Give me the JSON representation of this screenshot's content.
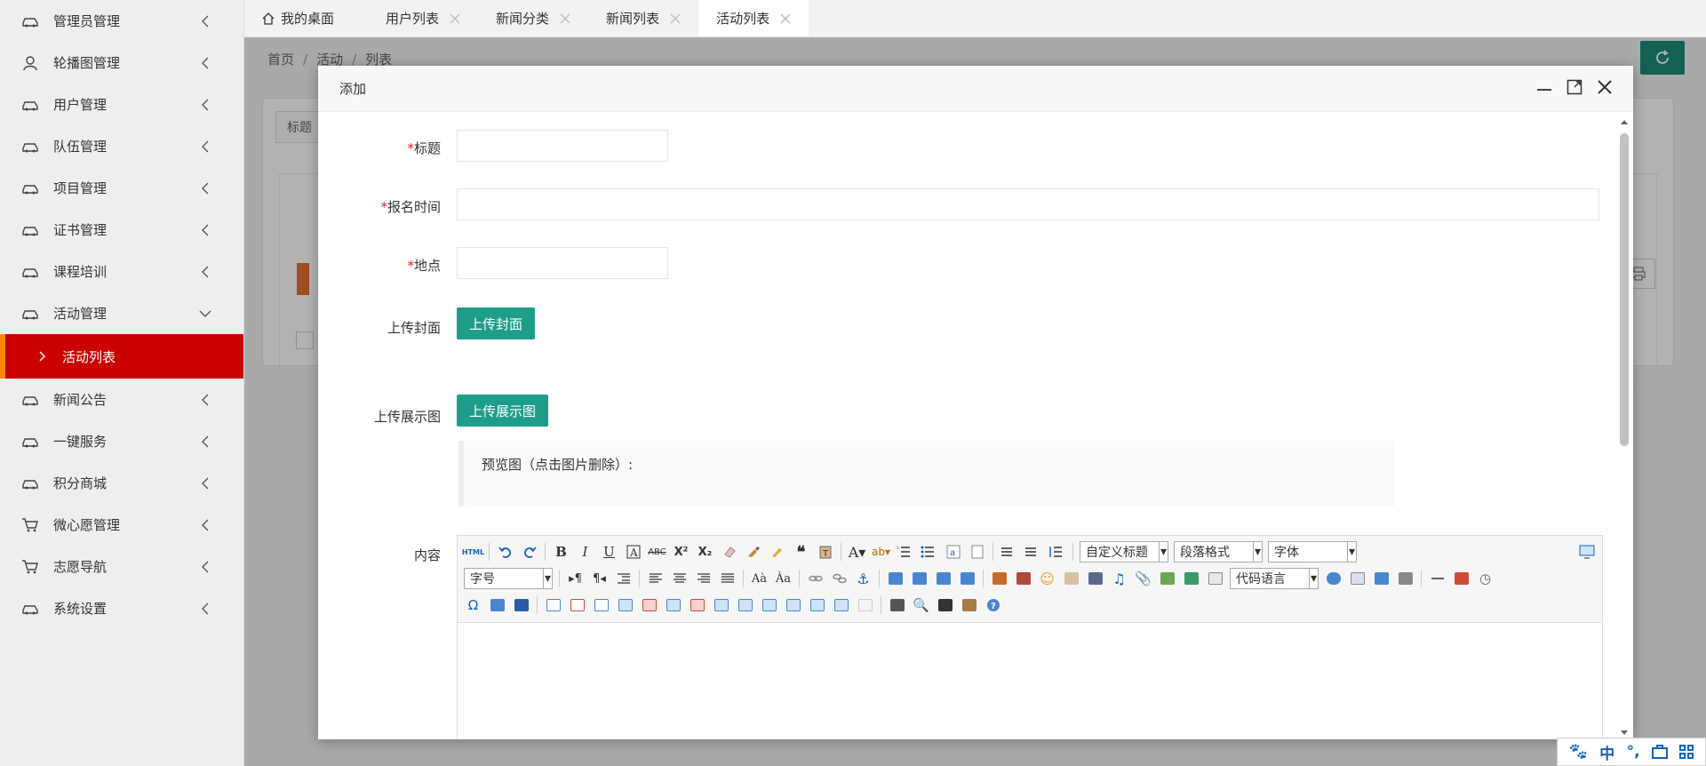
{
  "sidebar": {
    "items": [
      {
        "label": "管理员管理",
        "icon": "car-icon"
      },
      {
        "label": "轮播图管理",
        "icon": "user-icon"
      },
      {
        "label": "用户管理",
        "icon": "car-icon"
      },
      {
        "label": "队伍管理",
        "icon": "car-icon"
      },
      {
        "label": "项目管理",
        "icon": "car-icon"
      },
      {
        "label": "证书管理",
        "icon": "car-icon"
      },
      {
        "label": "课程培训",
        "icon": "car-icon"
      },
      {
        "label": "活动管理",
        "icon": "car-icon"
      },
      {
        "label": "新闻公告",
        "icon": "car-icon"
      },
      {
        "label": "一键服务",
        "icon": "car-icon"
      },
      {
        "label": "积分商城",
        "icon": "car-icon"
      },
      {
        "label": "微心愿管理",
        "icon": "cart-icon"
      },
      {
        "label": "志愿导航",
        "icon": "cart-icon"
      },
      {
        "label": "系统设置",
        "icon": "car-icon"
      }
    ],
    "active_sub": "活动列表"
  },
  "tabs": [
    {
      "label": "我的桌面"
    },
    {
      "label": "用户列表"
    },
    {
      "label": "新闻分类"
    },
    {
      "label": "新闻列表"
    },
    {
      "label": "活动列表"
    }
  ],
  "breadcrumb": {
    "home": "首页",
    "section": "活动",
    "page": "列表"
  },
  "background": {
    "filter_label": "标题"
  },
  "modal": {
    "title": "添加",
    "fields": {
      "title_label": "标题",
      "signup_time_label": "报名时间",
      "location_label": "地点",
      "cover_label": "上传封面",
      "cover_button": "上传封面",
      "gallery_label": "上传展示图",
      "gallery_button": "上传展示图",
      "preview_text": "预览图（点击图片删除）:",
      "content_label": "内容"
    },
    "required_mark": "*"
  },
  "editor": {
    "heading_select": "自定义标题",
    "paragraph_select": "段落格式",
    "font_select": "字体",
    "size_select": "字号",
    "code_select": "代码语言",
    "html_label": "HTML"
  },
  "ime": {
    "lang": "中",
    "punct": "°,"
  },
  "colors": {
    "accent_red": "#cc0000",
    "accent_orange": "#ff8800",
    "teal": "#1e9e8a"
  }
}
